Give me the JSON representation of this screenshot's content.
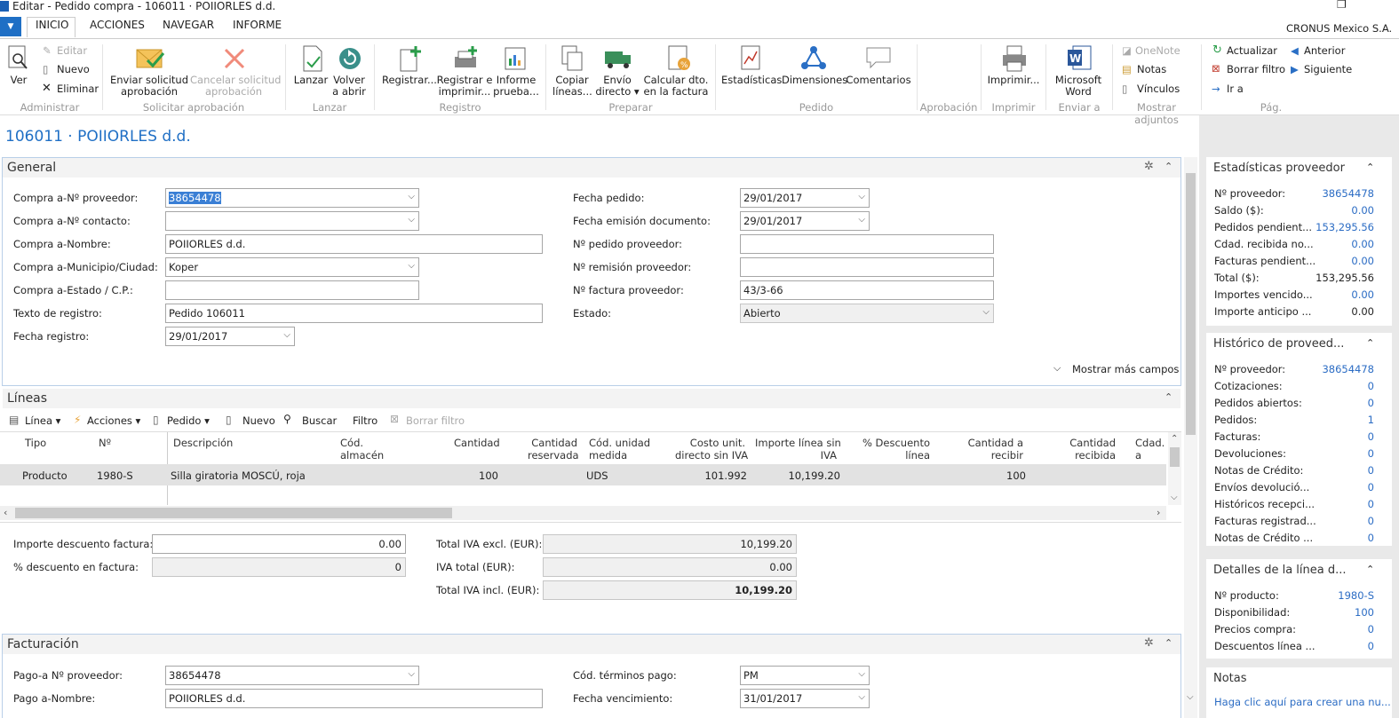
{
  "window": {
    "title": "Editar - Pedido compra - 106011 · POIIORLES d.d.",
    "company": "CRONUS Mexico S.A."
  },
  "tabs": [
    "INICIO",
    "ACCIONES",
    "NAVEGAR",
    "INFORME"
  ],
  "ribbon": {
    "ver": "Ver",
    "editar": "Editar",
    "nuevo": "Nuevo",
    "eliminar": "Eliminar",
    "enviar": "Enviar solicitud\naprobación",
    "cancelar": "Cancelar solicitud\naprobación",
    "lanzar": "Lanzar",
    "volver": "Volver\na abrir",
    "registrar": "Registrar...",
    "registrar_imprimir": "Registrar e\nimprimir...",
    "informe_prueba": "Informe\nprueba...",
    "copiar": "Copiar\nlíneas...",
    "envio": "Envío\ndirecto ▾",
    "calcular": "Calcular dto.\nen la factura",
    "estadisticas": "Estadísticas",
    "dimensiones": "Dimensiones",
    "comentarios": "Comentarios",
    "imprimir": "Imprimir...",
    "word": "Microsoft\nWord",
    "onenote": "OneNote",
    "notas": "Notas",
    "vinculos": "Vínculos",
    "actualizar": "Actualizar",
    "borrar_filtro": "Borrar filtro",
    "ir_a": "Ir a",
    "anterior": "Anterior",
    "siguiente": "Siguiente",
    "groups": [
      "Administrar",
      "Solicitar aprobación",
      "Lanzar",
      "Registro",
      "Preparar",
      "Pedido",
      "Aprobación",
      "Imprimir",
      "Enviar a",
      "Mostrar adjuntos",
      "Pág."
    ]
  },
  "page_title": "106011 · POIIORLES d.d.",
  "general": {
    "header": "General",
    "fields": [
      {
        "label": "Compra a-Nº proveedor:",
        "value": "38654478"
      },
      {
        "label": "Compra a-Nº contacto:",
        "value": ""
      },
      {
        "label": "Compra a-Nombre:",
        "value": "POIIORLES d.d."
      },
      {
        "label": "Compra a-Municipio/Ciudad:",
        "value": "Koper"
      },
      {
        "label": "Compra a-Estado / C.P.:",
        "value": ""
      },
      {
        "label": "Texto de registro:",
        "value": "Pedido 106011"
      },
      {
        "label": "Fecha registro:",
        "value": "29/01/2017"
      }
    ],
    "fields_right": [
      {
        "label": "Fecha pedido:",
        "value": "29/01/2017"
      },
      {
        "label": "Fecha emisión documento:",
        "value": "29/01/2017"
      },
      {
        "label": "Nº pedido proveedor:",
        "value": ""
      },
      {
        "label": "Nº remisión proveedor:",
        "value": ""
      },
      {
        "label": "Nº factura proveedor:",
        "value": "43/3-66"
      },
      {
        "label": "Estado:",
        "value": "Abierto"
      }
    ],
    "show_more": "Mostrar más campos"
  },
  "lines": {
    "header": "Líneas",
    "toolbar": [
      "Línea ▾",
      "Acciones ▾",
      "Pedido ▾",
      "Nuevo",
      "Buscar",
      "Filtro",
      "Borrar filtro"
    ],
    "columns": [
      "Tipo",
      "Nº",
      "Descripción",
      "Cód.\nalmacén",
      "Cantidad",
      "Cantidad\nreservada",
      "Cód. unidad\nmedida",
      "Costo unit.\ndirecto sin IVA",
      "Importe línea sin\nIVA",
      "% Descuento\nlínea",
      "Cantidad a\nrecibir",
      "Cantidad\nrecibida",
      "Cdad. a"
    ],
    "rows": [
      {
        "tipo": "Producto",
        "no": "1980-S",
        "desc": "Silla giratoria MOSCÚ, roja",
        "cantidad": "100",
        "um": "UDS",
        "costo": "101.992",
        "importe": "10,199.20",
        "recibir": "100"
      }
    ]
  },
  "totals": {
    "dto_label": "Importe descuento factura:",
    "dto_value": "0.00",
    "pct_label": "% descuento en factura:",
    "pct_value": "0",
    "excl_label": "Total IVA excl. (EUR):",
    "excl_value": "10,199.20",
    "iva_label": "IVA total (EUR):",
    "iva_value": "0.00",
    "incl_label": "Total IVA incl. (EUR):",
    "incl_value": "10,199.20"
  },
  "facturacion": {
    "header": "Facturación",
    "f1_label": "Pago-a Nº proveedor:",
    "f1_value": "38654478",
    "f2_label": "Pago a-Nombre:",
    "f2_value": "POIIORLES d.d.",
    "f3_label": "Cód. términos pago:",
    "f3_value": "PM",
    "f4_label": "Fecha vencimiento:",
    "f4_value": "31/01/2017"
  },
  "factbox1": {
    "title": "Estadísticas proveedor",
    "rows": [
      {
        "l": "Nº proveedor:",
        "v": "38654478"
      },
      {
        "l": "Saldo ($):",
        "v": "0.00"
      },
      {
        "l": "Pedidos pendient...",
        "v": "153,295.56"
      },
      {
        "l": "Cdad. recibida no...",
        "v": "0.00"
      },
      {
        "l": "Facturas pendient...",
        "v": "0.00"
      },
      {
        "l": "Total ($):",
        "v": "153,295.56"
      },
      {
        "l": "Importes vencido...",
        "v": "0.00"
      },
      {
        "l": "Importe anticipo ...",
        "v": "0.00"
      }
    ]
  },
  "factbox2": {
    "title": "Histórico de proveed...",
    "rows": [
      {
        "l": "Nº proveedor:",
        "v": "38654478"
      },
      {
        "l": "Cotizaciones:",
        "v": "0"
      },
      {
        "l": "Pedidos abiertos:",
        "v": "0"
      },
      {
        "l": "Pedidos:",
        "v": "1"
      },
      {
        "l": "Facturas:",
        "v": "0"
      },
      {
        "l": "Devoluciones:",
        "v": "0"
      },
      {
        "l": "Notas de Crédito:",
        "v": "0"
      },
      {
        "l": "Envíos devolució...",
        "v": "0"
      },
      {
        "l": "Históricos recepci...",
        "v": "0"
      },
      {
        "l": "Facturas registrad...",
        "v": "0"
      },
      {
        "l": "Notas de Crédito ...",
        "v": "0"
      }
    ]
  },
  "factbox3": {
    "title": "Detalles de la línea d...",
    "rows": [
      {
        "l": "Nº producto:",
        "v": "1980-S"
      },
      {
        "l": "Disponibilidad:",
        "v": "100"
      },
      {
        "l": "Precios compra:",
        "v": "0"
      },
      {
        "l": "Descuentos línea ...",
        "v": "0"
      }
    ]
  },
  "factbox4": {
    "title": "Notas",
    "link": "Haga clic aquí para crear una nu..."
  }
}
